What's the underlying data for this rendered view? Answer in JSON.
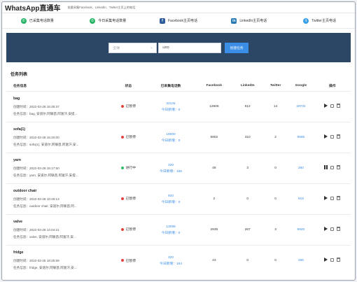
{
  "header": {
    "brand": "WhatsApp直通车",
    "subtitle": "批量采集Facebook、LinkedIn、Twitter主页上的电话"
  },
  "stats": [
    {
      "icon": "whatsapp-icon",
      "label": "已采集电话数量",
      "color": "#25b464"
    },
    {
      "icon": "whatsapp-icon",
      "label": "今日采集电话数量",
      "color": "#25b464"
    },
    {
      "icon": "facebook-icon",
      "label": "Facebook主页电话",
      "color": "#2f5d9b"
    },
    {
      "icon": "linkedin-icon",
      "label": "LinkedIn主页电话",
      "color": "#2a7ab5"
    },
    {
      "icon": "twitter-icon",
      "label": "Twitter主页电话",
      "color": "#3aa0e8"
    }
  ],
  "search": {
    "country_placeholder": "全球",
    "keyword_value": "LED",
    "create_label": "创建任务"
  },
  "section_title": "任务列表",
  "columns": [
    "任务信息",
    "状态",
    "已采集电话数",
    "Facebook",
    "LinkedIn",
    "Twitter",
    "Google",
    "操作"
  ],
  "tasks": [
    {
      "name": "bag",
      "created": "创建时间：2022-03-28 15:48:37",
      "info": "任务信息：bag, 安道尔,阿联酋,阿富汗,安提...",
      "status": "已暂停",
      "status_color": "#e2433d",
      "collected": "32134",
      "today": "今日新增：0",
      "facebook": "12606",
      "linkedin": "612",
      "twitter": "14",
      "google": "19702",
      "action": "play"
    },
    {
      "name": "sofa(1)",
      "created": "创建时间：2022-03-28 15:20:00",
      "info": "任务信息：sofa(1), 安道尔,阿联酋,阿富汗,安...",
      "status": "已暂停",
      "status_color": "#e2433d",
      "collected": "16000",
      "today": "今日新增：0",
      "facebook": "5902",
      "linkedin": "310",
      "twitter": "2",
      "google": "9686",
      "action": "play"
    },
    {
      "name": "yarn",
      "created": "创建时间：2022-03-28 15:17:50",
      "info": "任务信息：yarn, 安道尔,阿联酋,阿富汗,安提...",
      "status": "进行中",
      "status_color": "#2fbf6a",
      "collected": "320",
      "today": "今日新增：165",
      "facebook": "48",
      "linkedin": "3",
      "twitter": "0",
      "google": "280",
      "action": "pause"
    },
    {
      "name": "outdoor chair",
      "created": "创建时间：2022-03-28 10:49:13",
      "info": "任务信息：outdoor chair, 安道尔,阿联酋,阿...",
      "status": "已暂停",
      "status_color": "#e2433d",
      "collected": "920",
      "today": "今日新增：0",
      "facebook": "2",
      "linkedin": "0",
      "twitter": "0",
      "google": "918",
      "action": "play"
    },
    {
      "name": "valve",
      "created": "创建时间：2022-03-28 14:04:21",
      "info": "任务信息：valve, 安道尔,阿联酋,阿富汗,安...",
      "status": "已暂停",
      "status_color": "#e2433d",
      "collected": "13096",
      "today": "今日新增：0",
      "facebook": "2935",
      "linkedin": "267",
      "twitter": "3",
      "google": "9920",
      "action": "play"
    },
    {
      "name": "fridge",
      "created": "创建时间：2022-03-25 18:25:59",
      "info": "任务信息：fridge, 安道尔,阿联酋,阿富汗,安...",
      "status": "已暂停",
      "status_color": "#e2433d",
      "collected": "320",
      "today": "今日新增：164",
      "facebook": "43",
      "linkedin": "0",
      "twitter": "0",
      "google": "286",
      "action": "play"
    }
  ]
}
